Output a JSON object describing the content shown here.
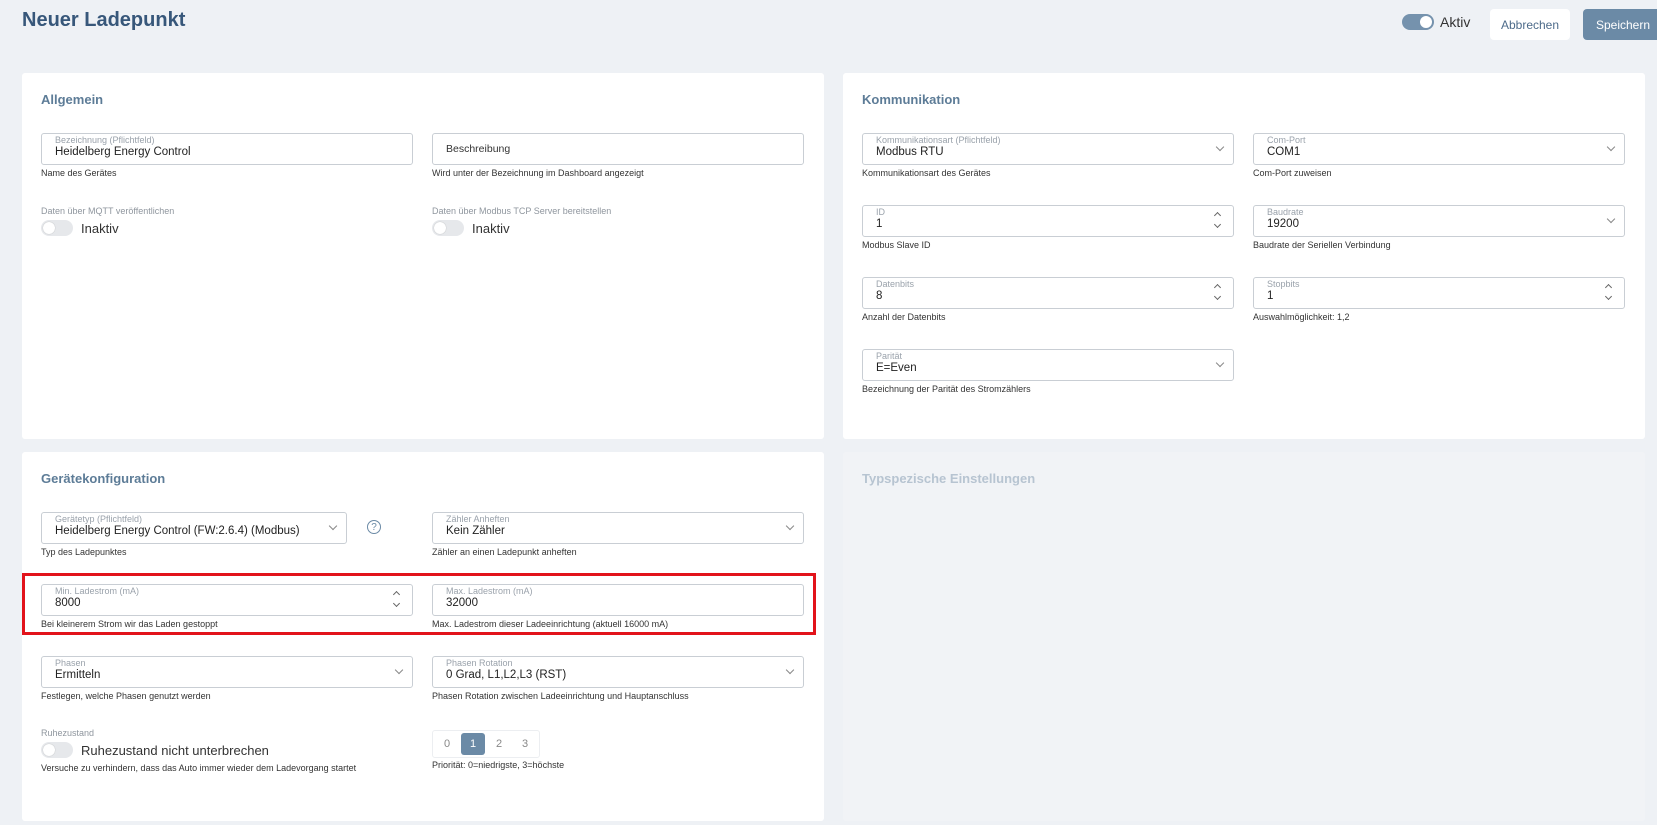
{
  "header": {
    "title": "Neuer Ladepunkt",
    "active_label": "Aktiv",
    "cancel_label": "Abbrechen",
    "save_label": "Speichern"
  },
  "allgemein": {
    "title": "Allgemein",
    "bezeichnung": {
      "label": "Bezeichnung (Pflichtfeld)",
      "value": "Heidelberg Energy Control",
      "hint": "Name des Gerätes"
    },
    "beschreibung": {
      "placeholder": "Beschreibung",
      "hint": "Wird unter der Bezeichnung im Dashboard angezeigt"
    },
    "mqtt": {
      "label": "Daten über MQTT veröffentlichen",
      "state": "Inaktiv"
    },
    "modbus_tcp": {
      "label": "Daten über Modbus TCP Server bereitstellen",
      "state": "Inaktiv"
    }
  },
  "kommunikation": {
    "title": "Kommunikation",
    "art": {
      "label": "Kommunikationsart (Pflichtfeld)",
      "value": "Modbus RTU",
      "hint": "Kommunikationsart des Gerätes"
    },
    "comport": {
      "label": "Com-Port",
      "value": "COM1",
      "hint": "Com-Port zuweisen"
    },
    "id": {
      "label": "ID",
      "value": "1",
      "hint": "Modbus Slave ID"
    },
    "baudrate": {
      "label": "Baudrate",
      "value": "19200",
      "hint": "Baudrate der Seriellen Verbindung"
    },
    "datenbits": {
      "label": "Datenbits",
      "value": "8",
      "hint": "Anzahl der Datenbits"
    },
    "stopbits": {
      "label": "Stopbits",
      "value": "1",
      "hint": "Auswahlmöglichkeit: 1,2"
    },
    "paritaet": {
      "label": "Parität",
      "value": "E=Even",
      "hint": "Bezeichnung der Parität des Stromzählers"
    }
  },
  "geraetekonfiguration": {
    "title": "Gerätekonfiguration",
    "geraetetyp": {
      "label": "Gerätetyp (Pflichtfeld)",
      "value": "Heidelberg Energy Control (FW:2.6.4) (Modbus)",
      "hint": "Typ des Ladepunktes",
      "help": "?"
    },
    "zaehler": {
      "label": "Zähler Anheften",
      "value": "Kein Zähler",
      "hint": "Zähler an einen Ladepunkt anheften"
    },
    "min_ladestrom": {
      "label": "Min. Ladestrom (mA)",
      "value": "8000",
      "hint": "Bei kleinerem Strom wir das Laden gestoppt"
    },
    "max_ladestrom": {
      "label": "Max. Ladestrom (mA)",
      "value": "32000",
      "hint": "Max. Ladestrom dieser Ladeeinrichtung (aktuell 16000 mA)"
    },
    "phasen": {
      "label": "Phasen",
      "value": "Ermitteln",
      "hint": "Festlegen, welche Phasen genutzt werden"
    },
    "phasen_rotation": {
      "label": "Phasen Rotation",
      "value": "0 Grad, L1,L2,L3 (RST)",
      "hint": "Phasen Rotation zwischen Ladeeinrichtung und Hauptanschluss"
    },
    "ruhezustand": {
      "label": "Ruhezustand",
      "state": "Ruhezustand nicht unterbrechen",
      "hint": "Versuche zu verhindern, dass das Auto immer wieder dem Ladevorgang startet"
    },
    "prioritaet": {
      "options": [
        "0",
        "1",
        "2",
        "3"
      ],
      "selected": "1",
      "hint": "Priorität: 0=niedrigste, 3=höchste"
    }
  },
  "typspezifisch": {
    "title": "Typspezische Einstellungen"
  },
  "colors": {
    "accent": "#6b8aa6",
    "title": "#37577a",
    "highlight": "#e2131b"
  }
}
